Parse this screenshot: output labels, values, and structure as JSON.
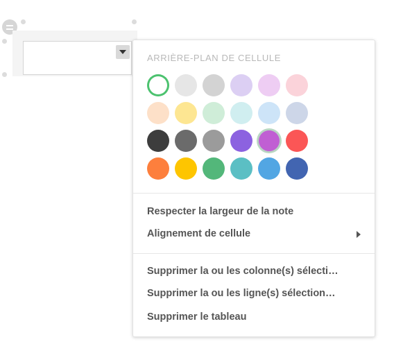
{
  "menu": {
    "heading": "ARRIÈRE-PLAN DE CELLULE",
    "swatches": [
      {
        "name": "white",
        "color": "#ffffff",
        "border": "#dcdcdc",
        "selected": true
      },
      {
        "name": "light-gray",
        "color": "#e6e6e6"
      },
      {
        "name": "gray",
        "color": "#d3d3d3"
      },
      {
        "name": "lavender",
        "color": "#dccff3"
      },
      {
        "name": "pink-lilac",
        "color": "#eecdf3"
      },
      {
        "name": "pink",
        "color": "#fbd3da"
      },
      {
        "name": "peach",
        "color": "#fde0c8"
      },
      {
        "name": "light-yellow",
        "color": "#fde692"
      },
      {
        "name": "mint",
        "color": "#cfedd8"
      },
      {
        "name": "light-cyan",
        "color": "#d0eef0"
      },
      {
        "name": "light-blue",
        "color": "#cde4f8"
      },
      {
        "name": "blue-gray",
        "color": "#cdd6e8"
      },
      {
        "name": "charcoal",
        "color": "#3d3d3d"
      },
      {
        "name": "dark-gray",
        "color": "#6b6b6b"
      },
      {
        "name": "medium-gray",
        "color": "#9b9b9b"
      },
      {
        "name": "purple",
        "color": "#8c62e0"
      },
      {
        "name": "magenta",
        "color": "#c05fd3",
        "hover": true
      },
      {
        "name": "red",
        "color": "#fb5656"
      },
      {
        "name": "orange",
        "color": "#fd7f3d"
      },
      {
        "name": "yellow",
        "color": "#fec500"
      },
      {
        "name": "green",
        "color": "#53b77a"
      },
      {
        "name": "teal",
        "color": "#5bbfc4"
      },
      {
        "name": "blue",
        "color": "#52a6e3"
      },
      {
        "name": "dark-blue",
        "color": "#4265b1"
      }
    ],
    "respect_width": "Respecter la largeur de la note",
    "cell_alignment": "Alignement de cellule",
    "delete_columns": "Supprimer la ou les colonne(s) sélecti…",
    "delete_rows": "Supprimer la ou les ligne(s) sélection…",
    "delete_table": "Supprimer le tableau"
  }
}
